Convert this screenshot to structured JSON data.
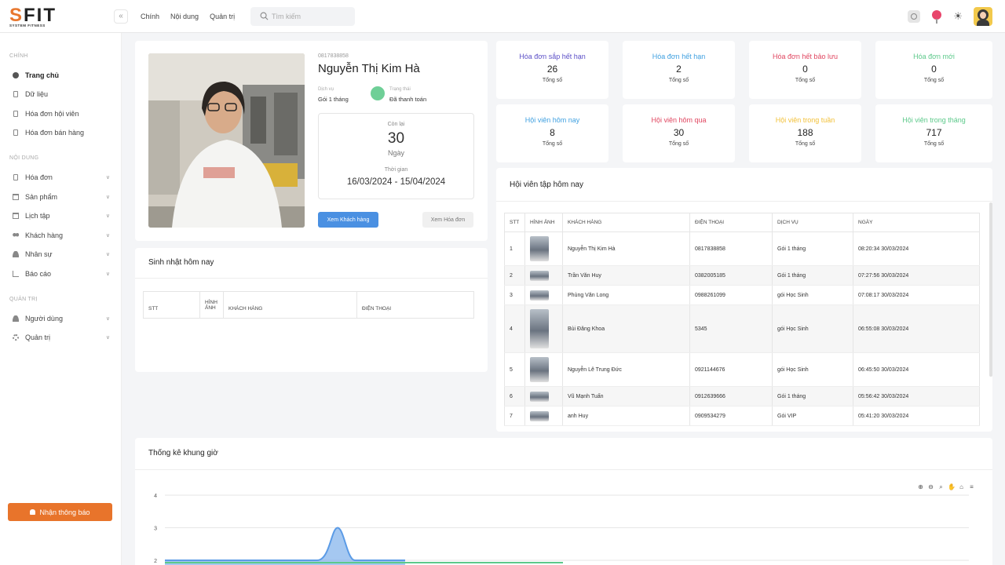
{
  "brand": {
    "logo_main": "SFIT",
    "logo_sub": "SYSTEM FITNESS"
  },
  "topbar": {
    "nav": [
      "Chính",
      "Nội dung",
      "Quản trị"
    ],
    "search_placeholder": "Tìm kiếm"
  },
  "sidebar": {
    "sections": [
      {
        "title": "CHÍNH",
        "items": [
          {
            "label": "Trang chủ",
            "icon": "dashboard-icon",
            "active": true
          },
          {
            "label": "Dữ liệu",
            "icon": "document-icon"
          },
          {
            "label": "Hóa đơn hội viên",
            "icon": "document-icon"
          },
          {
            "label": "Hóa đơn bán hàng",
            "icon": "document-icon"
          }
        ]
      },
      {
        "title": "NỘI DUNG",
        "items": [
          {
            "label": "Hóa đơn",
            "icon": "document-icon",
            "expandable": true
          },
          {
            "label": "Sản phẩm",
            "icon": "box-icon",
            "expandable": true
          },
          {
            "label": "Lịch tập",
            "icon": "calendar-icon",
            "expandable": true
          },
          {
            "label": "Khách hàng",
            "icon": "users-icon",
            "expandable": true
          },
          {
            "label": "Nhân sự",
            "icon": "user-icon",
            "expandable": true
          },
          {
            "label": "Báo cáo",
            "icon": "report-icon",
            "expandable": true
          }
        ]
      },
      {
        "title": "QUẢN TRỊ",
        "items": [
          {
            "label": "Người dùng",
            "icon": "user-icon",
            "expandable": true
          },
          {
            "label": "Quản trị",
            "icon": "gear-icon",
            "expandable": true
          }
        ]
      }
    ],
    "notify_button": "Nhận thông báo"
  },
  "profile": {
    "phone": "0817838858",
    "name": "Nguyễn Thị Kim Hà",
    "service_label": "Dịch vụ",
    "service": "Gói 1 tháng",
    "status_label": "Trạng thái",
    "status": "Đã thanh toán",
    "remaining_label": "Còn lại",
    "remaining": "30",
    "remaining_unit": "Ngày",
    "period_label": "Thời gian",
    "period": "16/03/2024 - 15/04/2024",
    "btn_customer": "Xem Khách hàng",
    "btn_invoice": "Xem Hóa đơn"
  },
  "stats": [
    {
      "title": "Hóa đơn sắp hết hạn",
      "value": "26",
      "sub": "Tổng số",
      "color": "#5b4fc7"
    },
    {
      "title": "Hóa đơn hết hạn",
      "value": "2",
      "sub": "Tổng số",
      "color": "#3fa0e0"
    },
    {
      "title": "Hóa đơn hết bảo lưu",
      "value": "0",
      "sub": "Tổng số",
      "color": "#e0455f"
    },
    {
      "title": "Hóa đơn mới",
      "value": "0",
      "sub": "Tổng số",
      "color": "#5cc98a"
    },
    {
      "title": "Hội viên hôm nay",
      "value": "8",
      "sub": "Tổng số",
      "color": "#3fa0e0"
    },
    {
      "title": "Hội viên hôm qua",
      "value": "30",
      "sub": "Tổng số",
      "color": "#e0455f"
    },
    {
      "title": "Hội viên trong tuần",
      "value": "188",
      "sub": "Tổng số",
      "color": "#f2c13a"
    },
    {
      "title": "Hội viên trong tháng",
      "value": "717",
      "sub": "Tổng số",
      "color": "#5cc98a"
    }
  ],
  "birthday": {
    "title": "Sinh nhật hôm nay",
    "columns": [
      "STT",
      "HÌNH ẢNH",
      "KHÁCH HÀNG",
      "ĐIỆN THOẠI"
    ]
  },
  "today_members": {
    "title": "Hội viên tập hôm nay",
    "columns": [
      "STT",
      "HÌNH ẢNH",
      "KHÁCH HÀNG",
      "ĐIỆN THOẠI",
      "DỊCH VỤ",
      "NGÀY"
    ],
    "rows": [
      {
        "stt": "1",
        "name": "Nguyễn Thị Kim Hà",
        "phone": "0817838858",
        "service": "Gói 1 tháng",
        "date": "08:20:34 30/03/2024",
        "thumb": "portrait"
      },
      {
        "stt": "2",
        "name": "Trần Văn Huy",
        "phone": "0382005185",
        "service": "Gói 1 tháng",
        "date": "07:27:56 30/03/2024",
        "thumb": "wide"
      },
      {
        "stt": "3",
        "name": "Phùng Văn Long",
        "phone": "0988261099",
        "service": "gói Học Sinh",
        "date": "07:08:17 30/03/2024",
        "thumb": "wide"
      },
      {
        "stt": "4",
        "name": "Bùi Đăng Khoa",
        "phone": "5345",
        "service": "gói Học Sinh",
        "date": "06:55:08 30/03/2024",
        "thumb": "tall"
      },
      {
        "stt": "5",
        "name": "Nguyễn Lê Trung Đức",
        "phone": "0921144676",
        "service": "gói Học Sinh",
        "date": "06:45:50 30/03/2024",
        "thumb": "portrait"
      },
      {
        "stt": "6",
        "name": "Vũ Mạnh Tuấn",
        "phone": "0912639666",
        "service": "Gói 1 tháng",
        "date": "05:56:42 30/03/2024",
        "thumb": "wide"
      },
      {
        "stt": "7",
        "name": "anh Huy",
        "phone": "0909534279",
        "service": "Gói VIP",
        "date": "05:41:20 30/03/2024",
        "thumb": "wide"
      }
    ]
  },
  "timeslot_chart": {
    "title": "Thống kê khung giờ",
    "chart_data": {
      "type": "area",
      "y_ticks": [
        "4",
        "3",
        "2"
      ],
      "ylim": [
        2,
        4
      ],
      "series": [
        {
          "values": [
            2,
            2,
            3,
            2,
            2
          ],
          "color": "#5b9be6"
        }
      ]
    }
  }
}
